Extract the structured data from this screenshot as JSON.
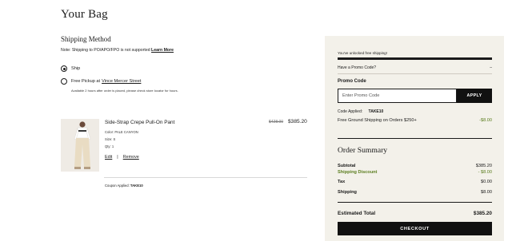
{
  "header": {
    "title": "Your Bag"
  },
  "shipping": {
    "title": "Shipping Method",
    "note_text": "Note: Shipping to PO/APO/FPO is not supported",
    "note_link": "Learn More",
    "options": [
      {
        "label": "Ship",
        "selected": true
      },
      {
        "label": "Free Pickup at",
        "store_link": "Vince Mercer Street",
        "selected": false,
        "subtext": "Available 2 hours after order is placed, please check store locator for hours."
      }
    ]
  },
  "cart": {
    "items": [
      {
        "name": "Side-Strap Crepe Pull-On Pant",
        "original_price": "$428.00",
        "price": "$385.20",
        "color": "Color: PALE CANYON",
        "size": "Size: S",
        "qty": "Qty: 1",
        "edit_label": "Edit",
        "separator": "|",
        "remove_label": "Remove",
        "coupon_label": "Coupon Applied:",
        "coupon_code": "TAKE10"
      }
    ]
  },
  "sidebar": {
    "free_shipping_message": "You've unlocked free shipping!",
    "free_shipping_progress": 1.0,
    "promo_toggle_label": "Have a Promo Code?",
    "promo_toggle_icon": "–",
    "promo_code_label": "Promo Code",
    "promo_placeholder": "Enter Promo Code",
    "apply_label": "APPLY",
    "code_applied_label": "Code Applied:",
    "code_applied_value": "TAKE10",
    "free_ground_label": "Free Ground Shipping on Orders $250+",
    "free_ground_value": "-$8.00",
    "summary_title": "Order Summary",
    "summary_rows": [
      {
        "label": "Subtotal",
        "value": "$385.20"
      },
      {
        "label": "Shipping Discount",
        "value": "- $8.00",
        "highlight": true
      },
      {
        "label": "Tax",
        "value": "$0.00"
      },
      {
        "label": "Shipping",
        "value": "$8.00"
      }
    ],
    "estimated_total_label": "Estimated Total",
    "estimated_total_value": "$385.20",
    "checkout_label": "CHECKOUT"
  },
  "colors": {
    "accent_green": "#5a7d1e",
    "sidebar_bg": "#f3f1ea",
    "button_bg": "#111111"
  }
}
